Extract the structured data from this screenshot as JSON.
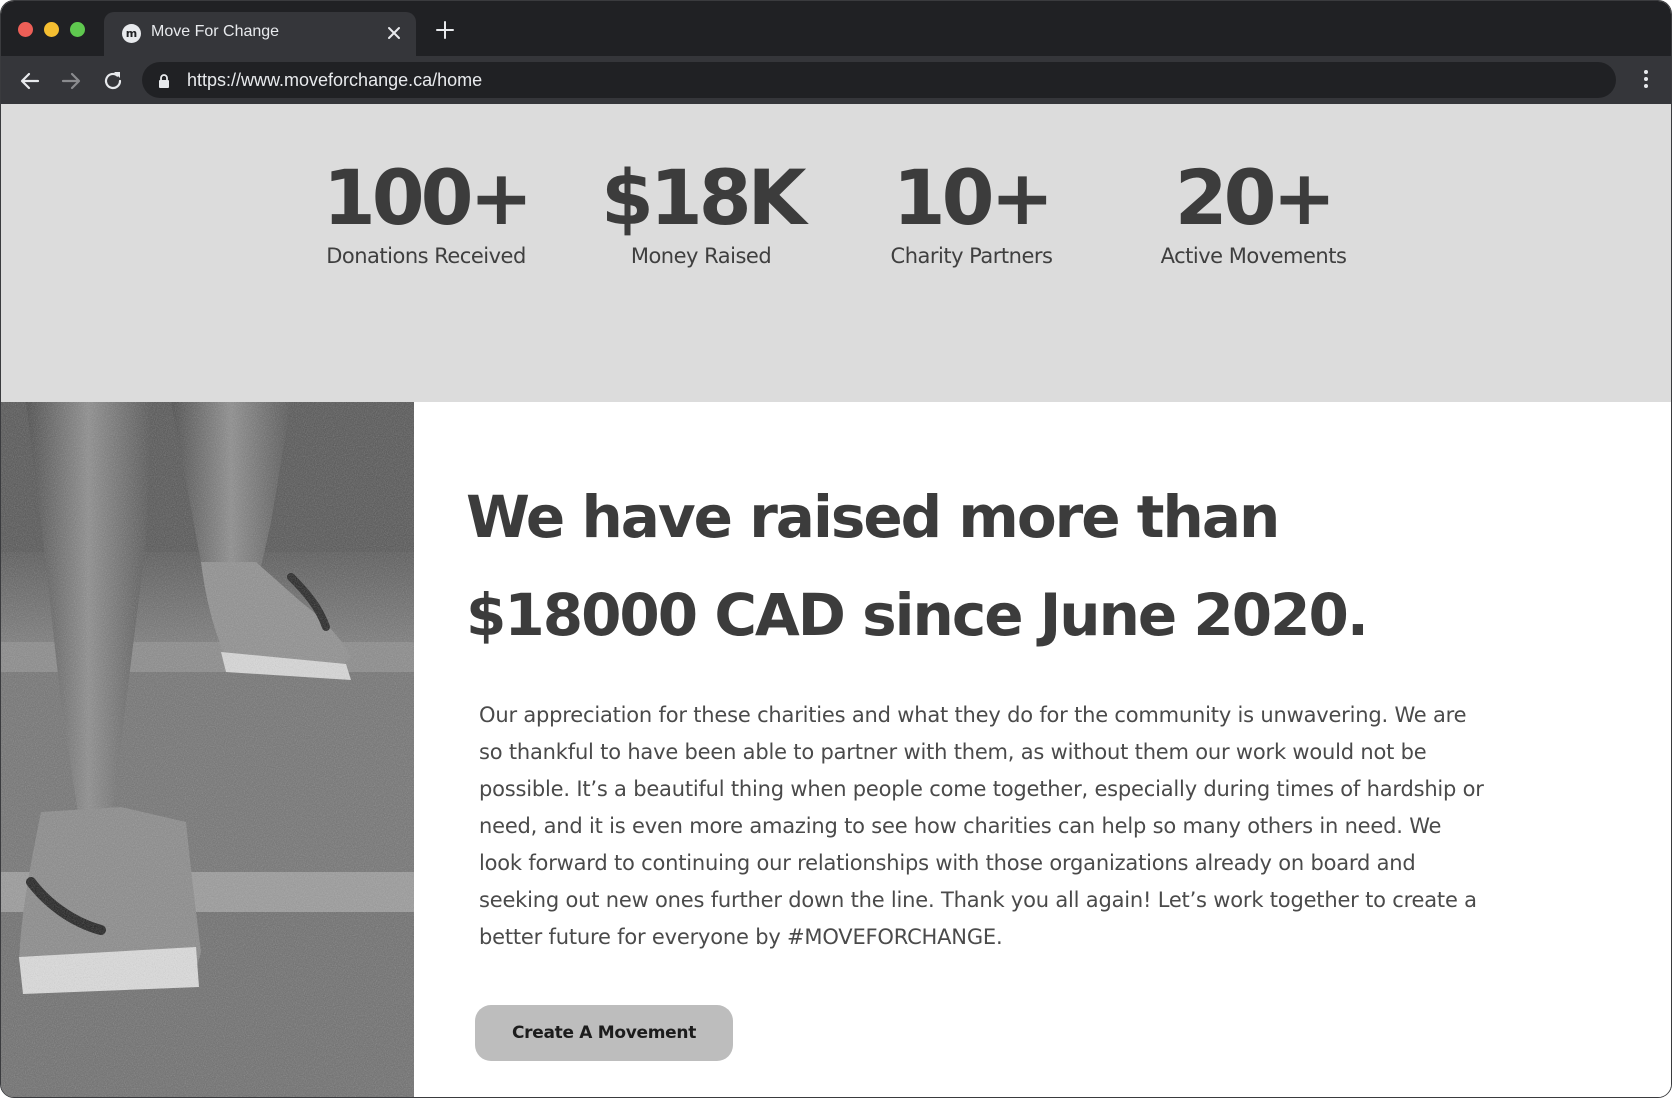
{
  "browser": {
    "tab": {
      "title": "Move For Change",
      "favicon_letter": "m",
      "close_icon": "close-icon"
    },
    "new_tab_icon": "plus-icon",
    "address_bar": {
      "url": "https://www.moveforchange.ca/home",
      "secure_icon": "lock-icon"
    },
    "nav_icons": [
      "back-arrow-icon",
      "forward-arrow-icon",
      "reload-icon"
    ],
    "menu_icon": "kebab-menu-icon"
  },
  "stats": [
    {
      "value": "100+",
      "label": "Donations Received"
    },
    {
      "value": "$18K",
      "label": "Money Raised"
    },
    {
      "value": "10+",
      "label": "Charity Partners"
    },
    {
      "value": "20+",
      "label": "Active Movements"
    }
  ],
  "feature": {
    "image_alt": "runner climbing stairs",
    "headline_line1": "We have raised more than",
    "headline_line2": "$18000 CAD since June 2020.",
    "body": "Our appreciation for these charities and what they do for the community is unwavering. We are so thankful to have been able to partner with them, as without them our work would not be possible. It’s a beautiful thing when people come together, especially during times of hardship or need, and it is even more amazing to see how charities can help so many others in need. We look forward to continuing our relationships with those organizations already on board and seeking out new ones further down the line. Thank you all again! Let’s work together to create a better future for everyone by #MOVEFORCHANGE.",
    "cta_label": "Create A Movement"
  },
  "colors": {
    "stats_background": "#dcdcdc",
    "text_dark": "#3c3c3c",
    "button_background": "#bdbdbd",
    "browser_chrome": "#202124"
  }
}
